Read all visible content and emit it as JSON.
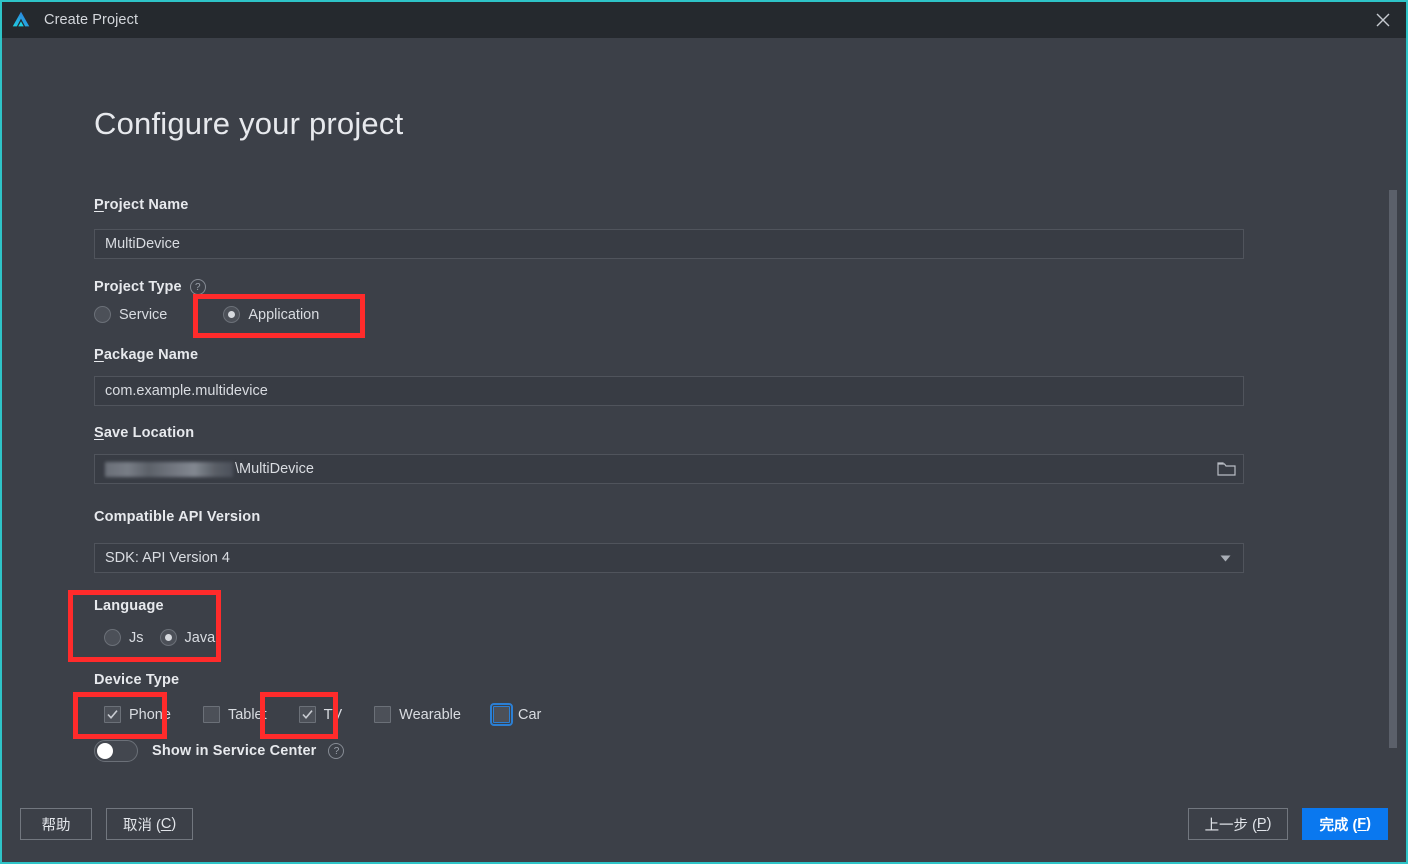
{
  "window": {
    "title": "Create Project",
    "logo_icon": "deveco-logo-icon",
    "close_icon": "close-icon",
    "accent_border": "#2ec4c8",
    "background": "#3c4048"
  },
  "page": {
    "heading": "Configure your project"
  },
  "fields": {
    "project_name": {
      "label_pre": "",
      "label_mnemonic": "P",
      "label_post": "roject Name",
      "value": "MultiDevice",
      "placeholder": "Project Name"
    },
    "project_type": {
      "label": "Project Type",
      "help_icon": "question-mark-icon",
      "options": [
        {
          "label": "Service",
          "selected": false
        },
        {
          "label": "Application",
          "selected": true
        }
      ]
    },
    "package_name": {
      "label_mnemonic": "P",
      "label_post": "ackage Name",
      "value": "com.example.multidevice",
      "placeholder": "Package Name"
    },
    "save_location": {
      "label_mnemonic": "S",
      "label_post": "ave Location",
      "value_redacted": true,
      "value_visible": "\\MultiDevice",
      "browse_icon": "folder-icon"
    },
    "compatible_api_version": {
      "label": "Compatible API Version",
      "value": "SDK: API Version 4",
      "arrow_icon": "chevron-down-icon"
    },
    "language": {
      "label": "Language",
      "options": [
        {
          "label": "Js",
          "selected": false
        },
        {
          "label": "Java",
          "selected": true
        }
      ]
    },
    "device_type": {
      "label": "Device Type",
      "options": [
        {
          "label": "Phone",
          "checked": true,
          "focused": false
        },
        {
          "label": "Tablet",
          "checked": false,
          "focused": false
        },
        {
          "label": "TV",
          "checked": true,
          "focused": false
        },
        {
          "label": "Wearable",
          "checked": false,
          "focused": false
        },
        {
          "label": "Car",
          "checked": false,
          "focused": true
        }
      ]
    },
    "show_in_service_center": {
      "label": "Show in Service Center",
      "enabled": false,
      "help_icon": "question-mark-icon"
    }
  },
  "footer": {
    "help_label": "帮助",
    "cancel_label_pre": "取消 (",
    "cancel_mnemonic": "C",
    "cancel_label_post": ")",
    "previous_label_pre": "上一步 (",
    "previous_mnemonic": "P",
    "previous_label_post": ")",
    "finish_label_pre": "完成 (",
    "finish_mnemonic": "F",
    "finish_label_post": ")",
    "primary_color": "#0a78ef"
  },
  "annotations": {
    "color": "#ff2b2b",
    "boxes": [
      {
        "name": "application-radio-highlight"
      },
      {
        "name": "language-group-highlight"
      },
      {
        "name": "phone-checkbox-highlight"
      },
      {
        "name": "tv-checkbox-highlight"
      }
    ]
  }
}
